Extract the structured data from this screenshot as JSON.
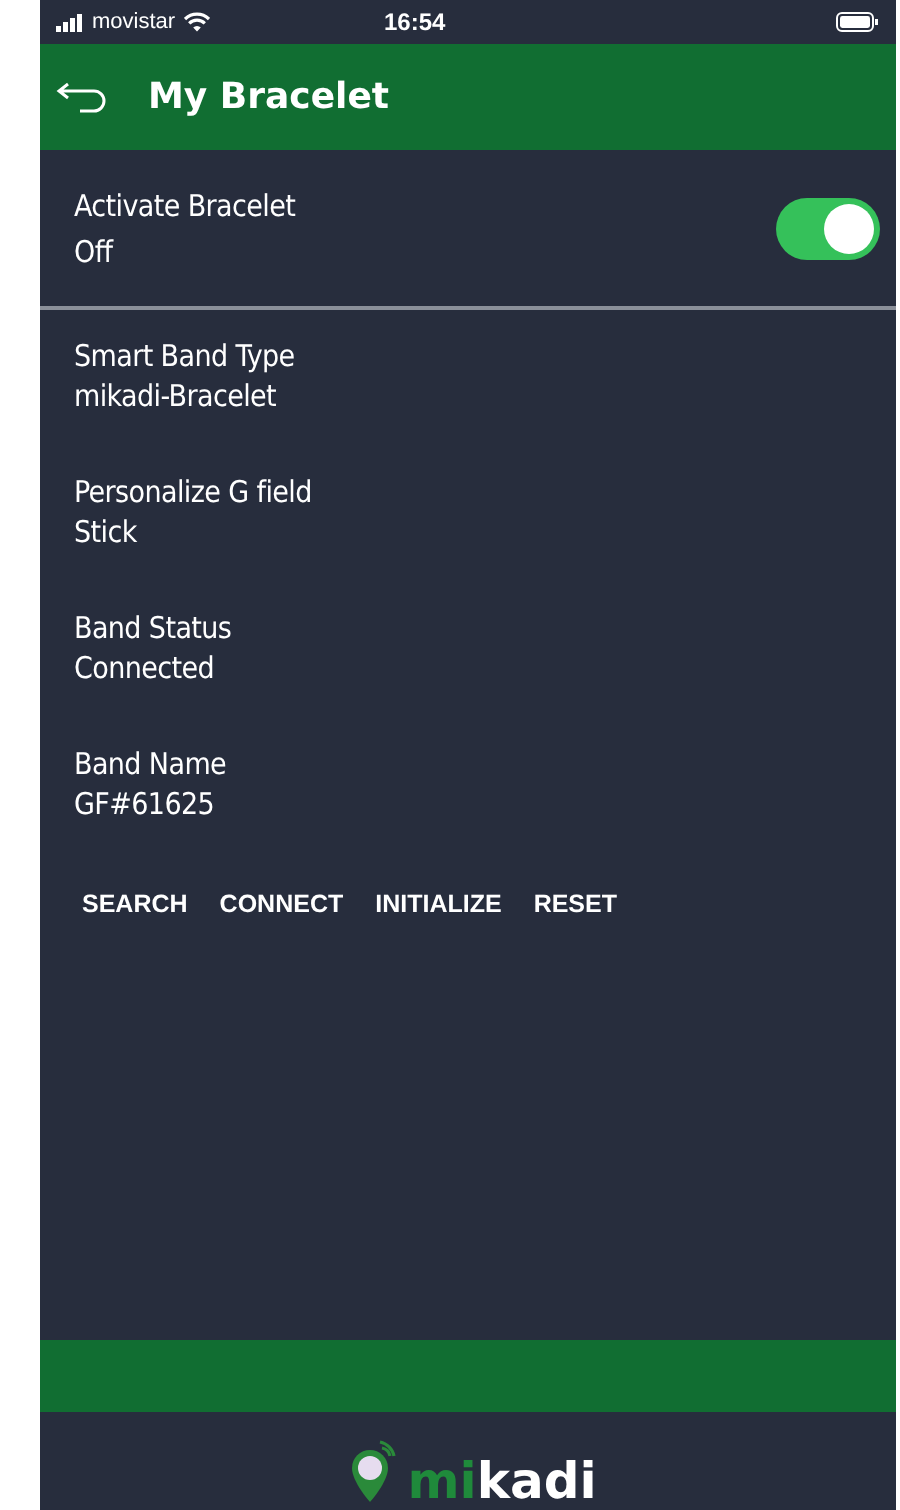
{
  "status_bar": {
    "carrier": "movistar",
    "time": "16:54"
  },
  "header": {
    "title": "My Bracelet"
  },
  "activate": {
    "label": "Activate Bracelet",
    "value": "Off",
    "on": true
  },
  "fields": [
    {
      "label": "Smart Band Type",
      "value": "mikadi-Bracelet"
    },
    {
      "label": "Personalize G field",
      "value": "Stick"
    },
    {
      "label": "Band Status",
      "value": "Connected"
    },
    {
      "label": "Band Name",
      "value": "GF#61625"
    }
  ],
  "buttons": [
    "SEARCH",
    "CONNECT",
    "INITIALIZE",
    "RESET"
  ],
  "logo": {
    "accent": "mi",
    "rest": "kadi"
  }
}
